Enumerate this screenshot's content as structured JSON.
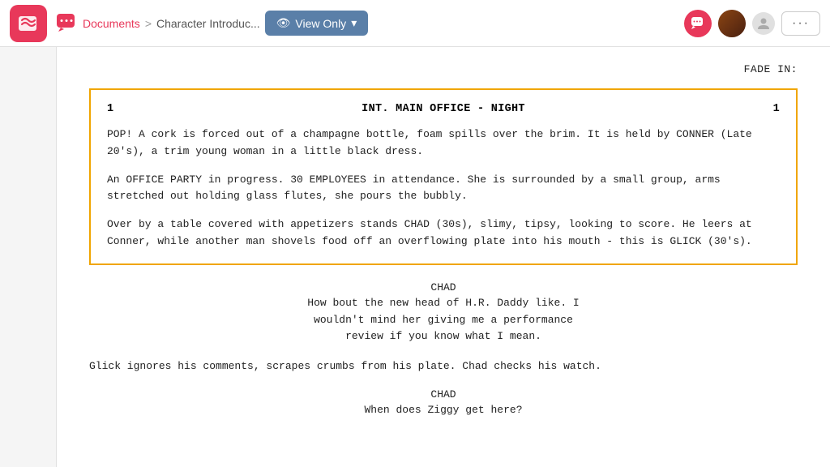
{
  "header": {
    "app_logo_alt": "WriterDuet",
    "breadcrumb": {
      "link_label": "Documents",
      "separator": ">",
      "current": "Character Introduc..."
    },
    "view_only_label": "View Only",
    "more_button": "···"
  },
  "script": {
    "fade_in": "FADE IN:",
    "scene_number_left": "1",
    "scene_number_right": "1",
    "scene_heading": "INT. MAIN OFFICE - NIGHT",
    "action_1": "POP! A cork is forced out of a champagne bottle, foam spills over the brim. It is held by CONNER (Late 20's), a trim young woman in a little black dress.",
    "action_2": "An OFFICE PARTY in progress. 30 EMPLOYEES in attendance. She is surrounded by a small group, arms stretched out holding glass flutes, she pours the bubbly.",
    "action_3": "Over by a table covered with appetizers stands CHAD (30s), slimy, tipsy, looking to score. He leers at Conner, while another man shovels food off an overflowing plate into his mouth - this is GLICK (30's).",
    "chad_name_1": "CHAD",
    "chad_dialogue_1": "How bout the new head of H.R. Daddy like. I wouldn't mind her giving me a performance review if you know what I mean.",
    "action_4": "Glick ignores his comments, scrapes crumbs from his plate. Chad checks his watch.",
    "chad_name_2": "CHAD",
    "chad_dialogue_2": "When does Ziggy get here?"
  }
}
